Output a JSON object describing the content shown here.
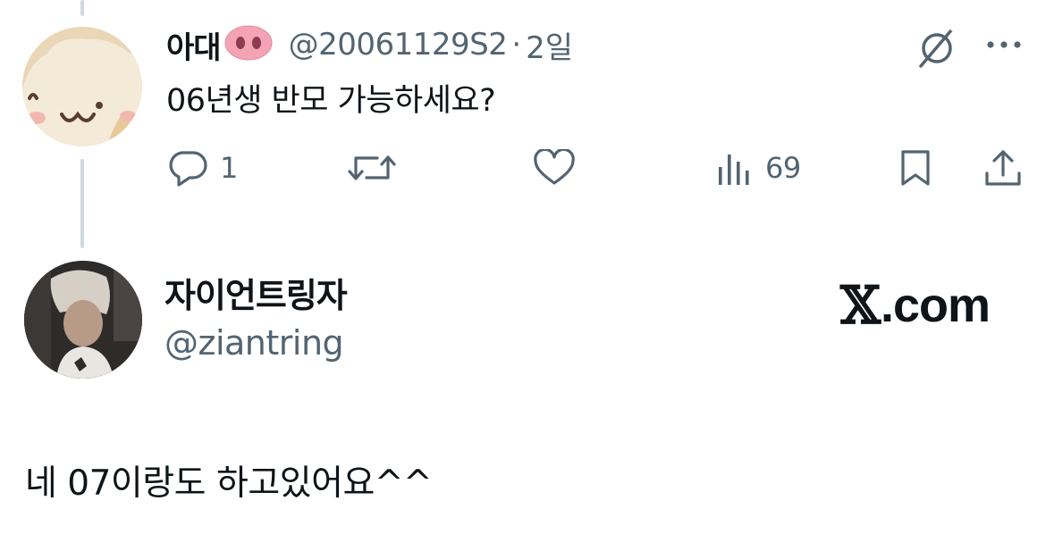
{
  "parent_tweet": {
    "display_name": "아대",
    "emoji": "pig-nose-emoji",
    "handle": "@20061129S2",
    "separator": "·",
    "time": "2일",
    "text": "06년생 반모 가능하세요?",
    "actions": {
      "reply_count": "1",
      "views_count": "69"
    }
  },
  "reply_tweet": {
    "display_name": "자이언트링자",
    "handle": "@ziantring",
    "text": "네 07이랑도 하고있어요^^"
  },
  "watermark": {
    "x_mark": "𝕏",
    "text": ".com"
  },
  "colors": {
    "text": "#0f1419",
    "secondary": "#536471",
    "thread_line": "#cfd9de",
    "pig": "#f4a3b5"
  }
}
